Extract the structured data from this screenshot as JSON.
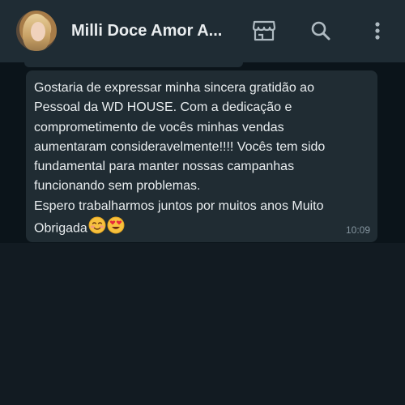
{
  "header": {
    "contact_name": "Milli Doce Amor A...",
    "icons": [
      "store-icon",
      "search-icon",
      "more-vertical-icon"
    ]
  },
  "chat": {
    "message": {
      "text": "Gostaria de expressar minha sincera gratidão ao\nPessoal da WD HOUSE. Com a dedicação e\ncomprometimento de vocês minhas vendas\naumentaram consideravelmente!!!! Vocês tem sido\nfundamental para manter nossas campanhas\nfuncionando sem problemas.\nEspero trabalharmos juntos por muitos anos Muito\nObrigada",
      "emojis": [
        "smiling-face-emoji",
        "heart-eyes-emoji"
      ],
      "time": "10:09"
    }
  },
  "colors": {
    "header_bg": "#1f2c34",
    "chat_bg": "#0b141a",
    "bubble_bg": "#202c33",
    "text": "#e9edef",
    "muted": "#8696a0"
  }
}
